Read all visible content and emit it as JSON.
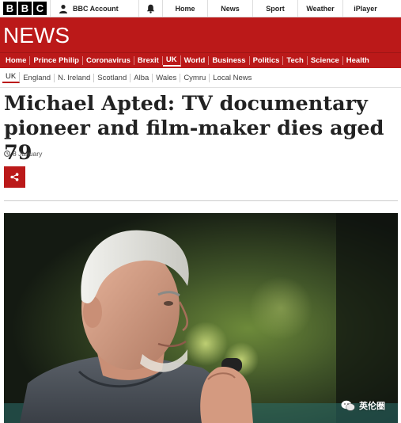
{
  "topbar": {
    "logo_letters": [
      "B",
      "B",
      "C"
    ],
    "account_label": "BBC Account",
    "nav": [
      "Home",
      "News",
      "Sport",
      "Weather",
      "iPlayer"
    ]
  },
  "banner": {
    "title": "NEWS",
    "color": "#bb1919"
  },
  "sections": {
    "items": [
      "Home",
      "Prince Philip",
      "Coronavirus",
      "Brexit",
      "UK",
      "World",
      "Business",
      "Politics",
      "Tech",
      "Science",
      "Health"
    ],
    "active": "UK"
  },
  "subsections": {
    "items": [
      "UK",
      "England",
      "N. Ireland",
      "Scotland",
      "Alba",
      "Wales",
      "Cymru",
      "Local News"
    ],
    "active": "UK"
  },
  "article": {
    "headline": "Michael Apted: TV documentary pioneer and film-maker dies aged 79",
    "date": "8 January"
  },
  "watermark": {
    "text": "英伦圈"
  }
}
